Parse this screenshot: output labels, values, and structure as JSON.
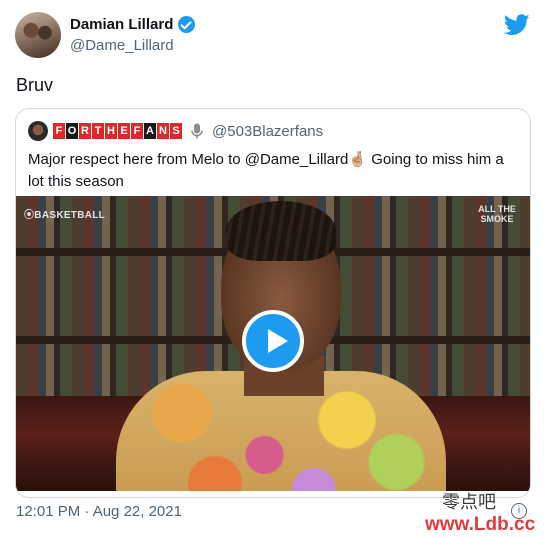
{
  "tweet": {
    "author_name": "Damian Lillard",
    "author_handle": "@Dame_Lillard",
    "text": "Bruv",
    "timestamp": "12:01 PM · Aug 22, 2021"
  },
  "quoted": {
    "brand_letters": [
      "F",
      "O",
      "R",
      "T",
      "H",
      "E",
      "F",
      "A",
      "N",
      "S"
    ],
    "handle": "@503Blazerfans",
    "text": "Major respect here from Melo to @Dame_Lillard🤞🏼 Going to miss him a lot this season",
    "video": {
      "watermark_left": "⦿BASKETBALL",
      "watermark_right": "ALL THE SMOKE"
    }
  },
  "watermark": {
    "cn": "零点吧",
    "url": "www.Ldb.cc"
  },
  "colors": {
    "accent": "#1d9bf0",
    "brand_red": "#e0262b",
    "secondary_text": "#536471"
  }
}
